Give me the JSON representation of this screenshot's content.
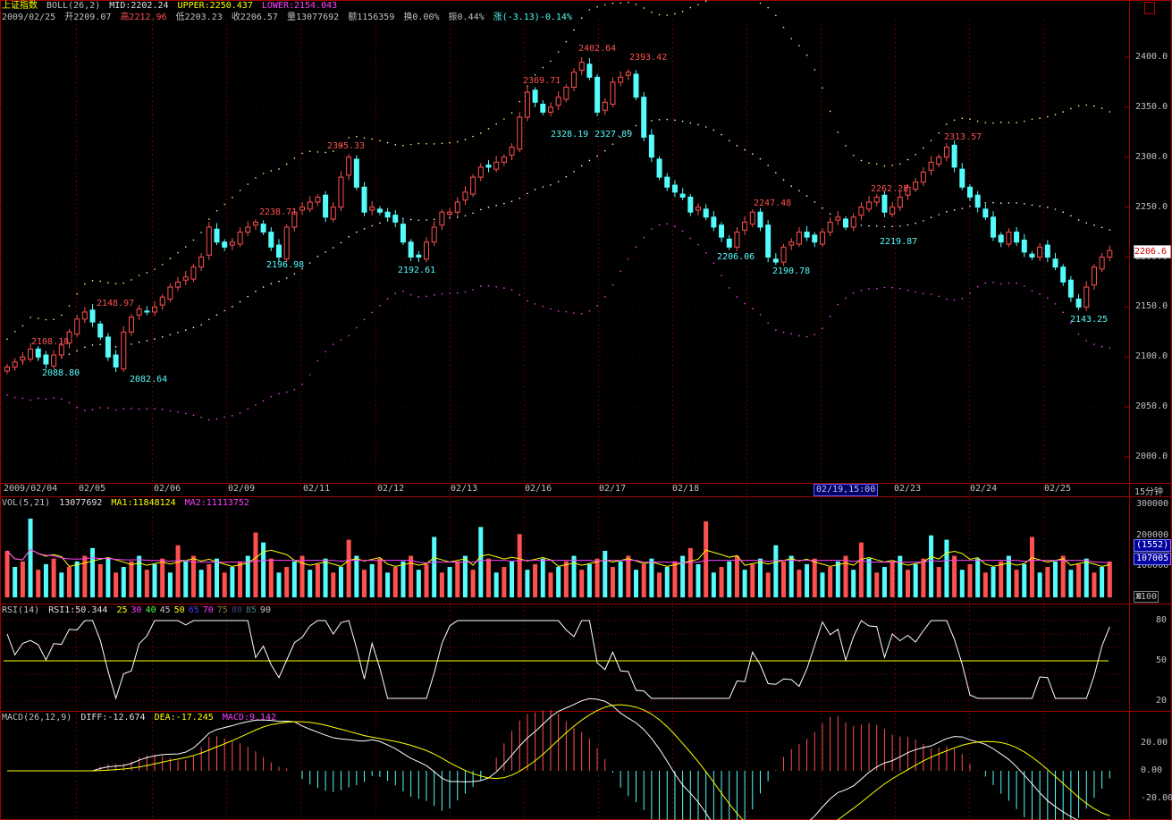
{
  "header": {
    "index_name": "上证指数",
    "indicator": "BOLL(26,2)",
    "mid": "MID:2202.24",
    "upper": "UPPER:2250.437",
    "lower": "LOWER:2154.043",
    "date": "2009/02/25",
    "open": "开2209.07",
    "high": "高2212.96",
    "low": "低2203.23",
    "close": "收2206.57",
    "volume": "量13077692",
    "amount": "额1156359",
    "turnover": "换0.00%",
    "amplitude": "振0.44%",
    "change": "涨(-3.13)-0.14%"
  },
  "price_axis": [
    "2400.0",
    "2350.0",
    "2300.0",
    "2250.0",
    "2200.0",
    "2150.0",
    "2100.0",
    "2050.0",
    "2000.0"
  ],
  "current_price_tag": "2206.6",
  "price_annotations_high": [
    {
      "text": "2108.18"
    },
    {
      "text": "2148.97"
    },
    {
      "text": "2238.71"
    },
    {
      "text": "2305.33"
    },
    {
      "text": "2369.71"
    },
    {
      "text": "2402.64"
    },
    {
      "text": "2393.42"
    },
    {
      "text": "2247.48"
    },
    {
      "text": "2262.28"
    },
    {
      "text": "2313.57"
    }
  ],
  "price_annotations_low": [
    {
      "text": "2088.80"
    },
    {
      "text": "2082.64"
    },
    {
      "text": "2196.98"
    },
    {
      "text": "2192.61"
    },
    {
      "text": "2328.19"
    },
    {
      "text": "2327.89"
    },
    {
      "text": "2206.06"
    },
    {
      "text": "2190.78"
    },
    {
      "text": "2219.87"
    },
    {
      "text": "2143.25"
    }
  ],
  "date_axis": [
    "2009/02/04",
    "02/05",
    "02/06",
    "02/09",
    "02/11",
    "02/12",
    "02/13",
    "02/16",
    "02/17",
    "02/18",
    "02/19",
    "02/23",
    "02/24",
    "02/25"
  ],
  "selected_date": "02/19,15:00",
  "period_label": "15分钟",
  "volume_panel": {
    "title": "VOL(5,21)",
    "value": "13077692",
    "ma1": "MA1:11848124",
    "ma2": "MA2:11113752",
    "axis": [
      "300000",
      "200000",
      "100000",
      "0"
    ],
    "box1": "(1552)",
    "box2": "107005",
    "multiplier": "X100"
  },
  "rsi_panel": {
    "title": "RSI(14)",
    "value": "RSI1:50.344",
    "levels": [
      "25",
      "30",
      "40",
      "45",
      "50",
      "65",
      "70",
      "75",
      "80",
      "85",
      "90"
    ],
    "axis": [
      "80",
      "50",
      "20"
    ]
  },
  "macd_panel": {
    "title": "MACD(26,12,9)",
    "diff": "DIFF:-12.674",
    "dea": "DEA:-17.245",
    "macd": "MACD:9.142",
    "axis": [
      "20.00",
      "0.00",
      "-20.00"
    ]
  },
  "colors": {
    "up": "#ff5050",
    "down": "#54fcfc",
    "frame": "#a00000",
    "grid": "#800000",
    "mid_band": "#ffffff",
    "upper_band": "#ffff80",
    "lower_band": "#ff40ff",
    "rsi_line": "#ffffff",
    "rsi_ref": "#ffff00",
    "vol_ma1": "#ffff00",
    "vol_ma2": "#ff40ff",
    "macd_diff": "#ffffff",
    "macd_dea": "#ffff00"
  },
  "chart_data": {
    "type": "candlestick",
    "close_series_key": [
      2090,
      2095,
      2100,
      2108,
      2100,
      2093,
      2102,
      2112,
      2125,
      2138,
      2145,
      2135,
      2120,
      2100,
      2090,
      2125,
      2140,
      2148,
      2145,
      2150,
      2160,
      2170,
      2175,
      2180,
      2190,
      2200,
      2230,
      2215,
      2210,
      2215,
      2225,
      2230,
      2235,
      2225,
      2210,
      2200,
      2230,
      2245,
      2250,
      2255,
      2260,
      2240,
      2250,
      2280,
      2300,
      2270,
      2245,
      2250,
      2245,
      2240,
      2235,
      2215,
      2200,
      2200,
      2215,
      2230,
      2245,
      2245,
      2255,
      2265,
      2280,
      2290,
      2290,
      2295,
      2300,
      2310,
      2340,
      2365,
      2355,
      2345,
      2350,
      2360,
      2370,
      2385,
      2395,
      2380,
      2345,
      2355,
      2375,
      2380,
      2385,
      2360,
      2320,
      2300,
      2280,
      2270,
      2265,
      2260,
      2245,
      2250,
      2240,
      2230,
      2220,
      2210,
      2225,
      2235,
      2245,
      2230,
      2200,
      2195,
      2210,
      2215,
      2225,
      2220,
      2215,
      2225,
      2235,
      2240,
      2230,
      2240,
      2250,
      2255,
      2260,
      2245,
      2250,
      2260,
      2270,
      2275,
      2285,
      2295,
      2300,
      2310,
      2290,
      2270,
      2260,
      2250,
      2240,
      2220,
      2215,
      2225,
      2215,
      2205,
      2200,
      2210,
      2200,
      2190,
      2175,
      2160,
      2150,
      2170,
      2190,
      2200,
      2206.57
    ]
  }
}
